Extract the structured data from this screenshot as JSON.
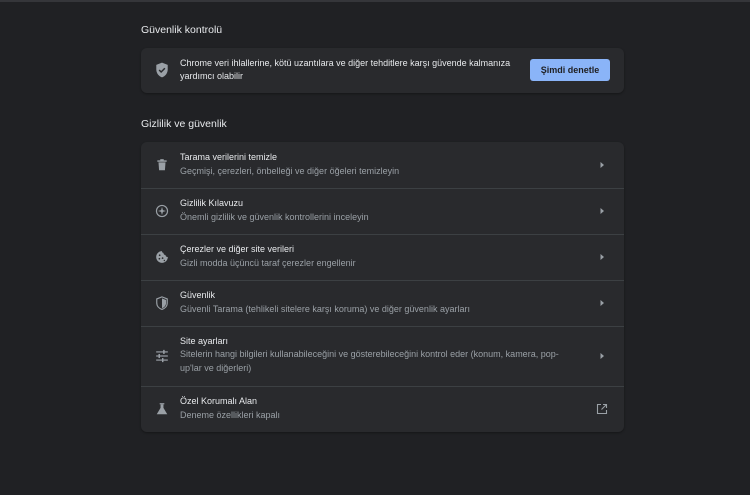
{
  "colors": {
    "background": "#202124",
    "card": "#292a2d",
    "accent": "#8ab4f8",
    "text_primary": "#e8eaed",
    "text_secondary": "#9aa0a6"
  },
  "safety_check": {
    "section_title": "Güvenlik kontrolü",
    "icon": "shield-check-icon",
    "description": "Chrome veri ihlallerine, kötü uzantılara ve diğer tehditlere karşı güvende kalmanıza yardımcı olabilir",
    "button_label": "Şimdi denetle"
  },
  "privacy": {
    "section_title": "Gizlilik ve güvenlik",
    "items": [
      {
        "icon": "trash-icon",
        "title": "Tarama verilerini temizle",
        "subtitle": "Geçmişi, çerezleri, önbelleği ve diğer öğeleri temizleyin",
        "action_icon": "chevron-right-icon"
      },
      {
        "icon": "compass-icon",
        "title": "Gizlilik Kılavuzu",
        "subtitle": "Önemli gizlilik ve güvenlik kontrollerini inceleyin",
        "action_icon": "chevron-right-icon"
      },
      {
        "icon": "cookie-icon",
        "title": "Çerezler ve diğer site verileri",
        "subtitle": "Gizli modda üçüncü taraf çerezler engellenir",
        "action_icon": "chevron-right-icon"
      },
      {
        "icon": "shield-icon",
        "title": "Güvenlik",
        "subtitle": "Güvenli Tarama (tehlikeli sitelere karşı koruma) ve diğer güvenlik ayarları",
        "action_icon": "chevron-right-icon"
      },
      {
        "icon": "tune-icon",
        "title": "Site ayarları",
        "subtitle": "Sitelerin hangi bilgileri kullanabileceğini ve gösterebileceğini kontrol eder (konum, kamera, pop-up'lar ve diğerleri)",
        "action_icon": "chevron-right-icon"
      },
      {
        "icon": "flask-icon",
        "title": "Özel Korumalı Alan",
        "subtitle": "Deneme özellikleri kapalı",
        "action_icon": "open-in-new-icon"
      }
    ]
  }
}
